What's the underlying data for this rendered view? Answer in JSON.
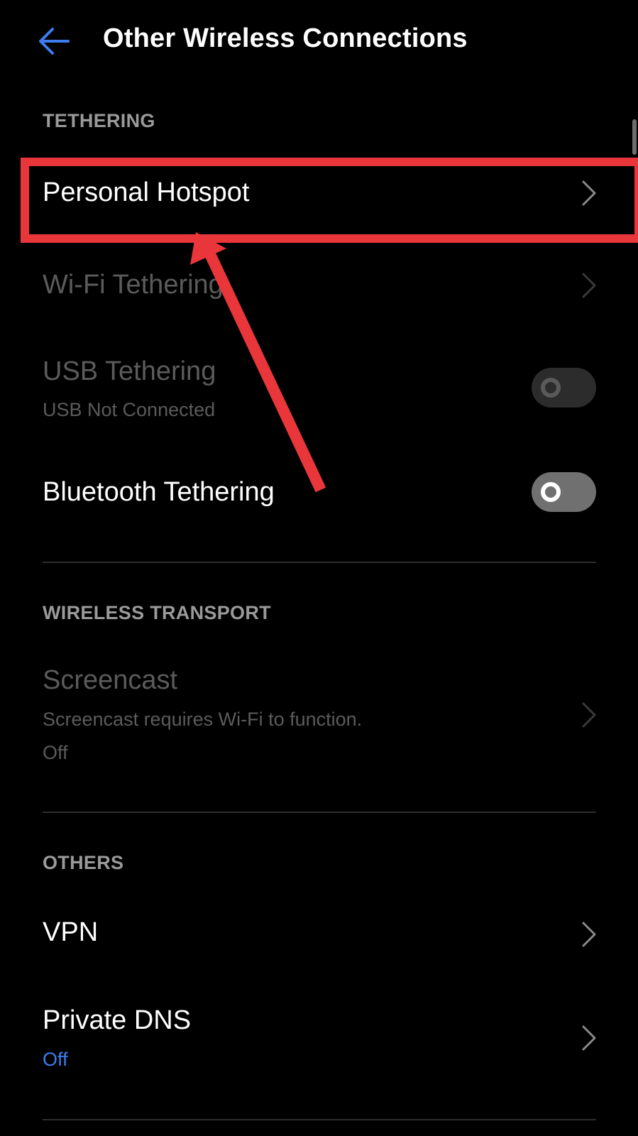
{
  "header": {
    "back_icon": "arrow-left-icon",
    "title": "Other Wireless Connections"
  },
  "sections": {
    "tethering": {
      "header": "TETHERING",
      "personal_hotspot": {
        "title": "Personal Hotspot"
      },
      "wifi_tethering": {
        "title": "Wi-Fi Tethering"
      },
      "usb_tethering": {
        "title": "USB Tethering",
        "subtitle": "USB Not Connected",
        "toggle_state": "off"
      },
      "bluetooth_tethering": {
        "title": "Bluetooth Tethering",
        "toggle_state": "off"
      }
    },
    "wireless_transport": {
      "header": "WIRELESS TRANSPORT",
      "screencast": {
        "title": "Screencast",
        "subtitle": "Screencast requires Wi-Fi to function.",
        "status": "Off"
      }
    },
    "others": {
      "header": "OTHERS",
      "vpn": {
        "title": "VPN"
      },
      "private_dns": {
        "title": "Private DNS",
        "status": "Off"
      }
    }
  },
  "colors": {
    "background": "#000000",
    "accent": "#3e7cf0",
    "annotation": "#e8363a",
    "disabled_text": "#5b5b5b",
    "section_header": "#9a9a9a"
  }
}
